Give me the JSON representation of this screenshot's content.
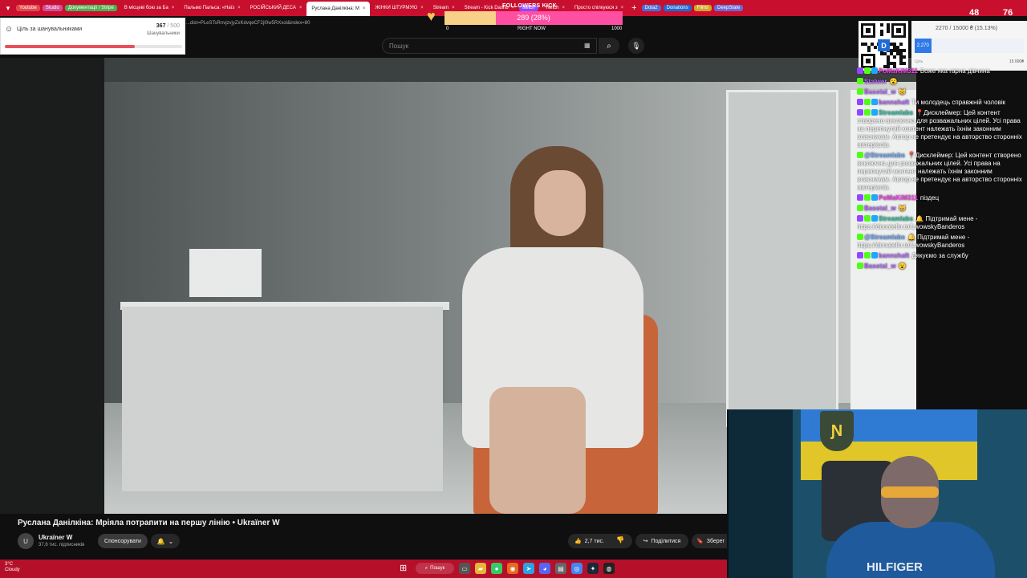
{
  "tabstrip": {
    "bookmarks": [
      {
        "label": "Youtube",
        "color": "#e24b4b"
      },
      {
        "label": "Studio",
        "color": "#d24e9a"
      },
      {
        "label": "Документації / Stripe",
        "color": "#4caf50"
      }
    ],
    "tabs": [
      {
        "label": "В місцеві бою за Ба"
      },
      {
        "label": "Пальмо Пальса: «Наїз"
      },
      {
        "label": "РОСІЙСЬКИЙ ДЕСА"
      },
      {
        "label": "Руслана Данілкіна: М"
      },
      {
        "label": "ЖІНКИ ШТУРМУЮ"
      },
      {
        "label": "Stream"
      },
      {
        "label": "Stream - Kick Dashb"
      },
      {
        "label": "Twitch"
      },
      {
        "label": "Просто спілкуюся з"
      }
    ],
    "right_bookmarks": [
      "Dota2",
      "Donations",
      "Films",
      "DeepState"
    ],
    "twitch_chip": "twitch"
  },
  "header": {
    "url": "...dist=PLeSTsRnvjzvjyZxKdvqeCF2jI0w5RXxol&index=80",
    "search_placeholder": "Пошук"
  },
  "goal": {
    "title": "Ціль за шанувальниками",
    "current": "367",
    "target": "/ 500",
    "sub": "Шанувальники",
    "fraction": 0.734
  },
  "followers_kick": {
    "title": "FOLLOWERS KICK",
    "value": "289 (28%)",
    "fraction": 0.289,
    "min": "0",
    "mid": "RIGHT NOW",
    "max": "1000"
  },
  "donation": {
    "progress": "2270 / 15000 ₴ (15.13%)",
    "current": "2.270",
    "min": "Ціль",
    "max": "15 000₴",
    "fraction": 0.1513
  },
  "counters": {
    "viewers": "48",
    "kick_viewers": "76"
  },
  "video": {
    "title": "Руслана Данілкіна: Мріяла потрапити на першу лінію • Ukraїner W",
    "channel": "Ukraїner W",
    "subs": "37,6 тис. підписників",
    "sponsor": "Спонсорувати",
    "likes": "2,7 тис.",
    "share": "Поділитися",
    "save": "Зберег"
  },
  "chat": [
    {
      "badges": [
        "tw",
        "kick",
        "sub"
      ],
      "user": "PoMaKiM311",
      "color": "u-pink",
      "text": "Боже яка гарна дівчина"
    },
    {
      "badges": [
        "kick"
      ],
      "user": "Stalwer",
      "color": "u-purple",
      "text": "😮"
    },
    {
      "badges": [
        "kick"
      ],
      "user": "Basotal_w",
      "color": "u-purple",
      "text": "😸"
    },
    {
      "badges": [
        "tw",
        "kick",
        "sub"
      ],
      "user": "bannshaft",
      "color": "u-purple",
      "text": "Ти молодець справжній чоловік"
    },
    {
      "badges": [
        "tw",
        "kick",
        "sub"
      ],
      "user": "Streamlabs",
      "color": "u-teal",
      "text": "📍Дисклеймер: Цей контент створено виключно для розважальних цілей. Усі права на перепнутий контент належать їхнім законним власникам. Автор не претендує на авторство сторонніх матеріалів."
    },
    {
      "badges": [
        "kick"
      ],
      "user": "@Streamlabs",
      "color": "u-blue",
      "text": "📍Дисклеймер: Цей контент створено виключно для розважальних цілей. Усі права на перепнутий контент належать їхнім законним власникам. Автор не претендує на авторство сторонніх матеріалів."
    },
    {
      "badges": [
        "tw",
        "kick",
        "sub"
      ],
      "user": "PoMaKiM311",
      "color": "u-pink",
      "text": "піздец"
    },
    {
      "badges": [
        "kick"
      ],
      "user": "Basotal_w",
      "color": "u-purple",
      "text": "😸"
    },
    {
      "badges": [
        "tw",
        "kick",
        "sub"
      ],
      "user": "Streamlabs",
      "color": "u-teal",
      "text": "🔔 Підтримай мене - https://donatello.to/LwowskyBanderos"
    },
    {
      "badges": [
        "kick"
      ],
      "user": "@Streamlabs",
      "color": "u-blue",
      "text": "🔔 Підтримай мене - https://donatello.to/LwowskyBanderos"
    },
    {
      "badges": [
        "tw",
        "kick",
        "sub"
      ],
      "user": "bannshaft",
      "color": "u-purple",
      "text": "Дякуємо за службу"
    },
    {
      "badges": [
        "kick"
      ],
      "user": "Basotal_w",
      "color": "u-purple",
      "text": "😮"
    }
  ],
  "camera": {
    "brand": "HILFIGER",
    "emblem": "Ɲ"
  },
  "taskbar": {
    "temp": "3°C",
    "weather": "Cloudy",
    "search": "Пошук"
  }
}
